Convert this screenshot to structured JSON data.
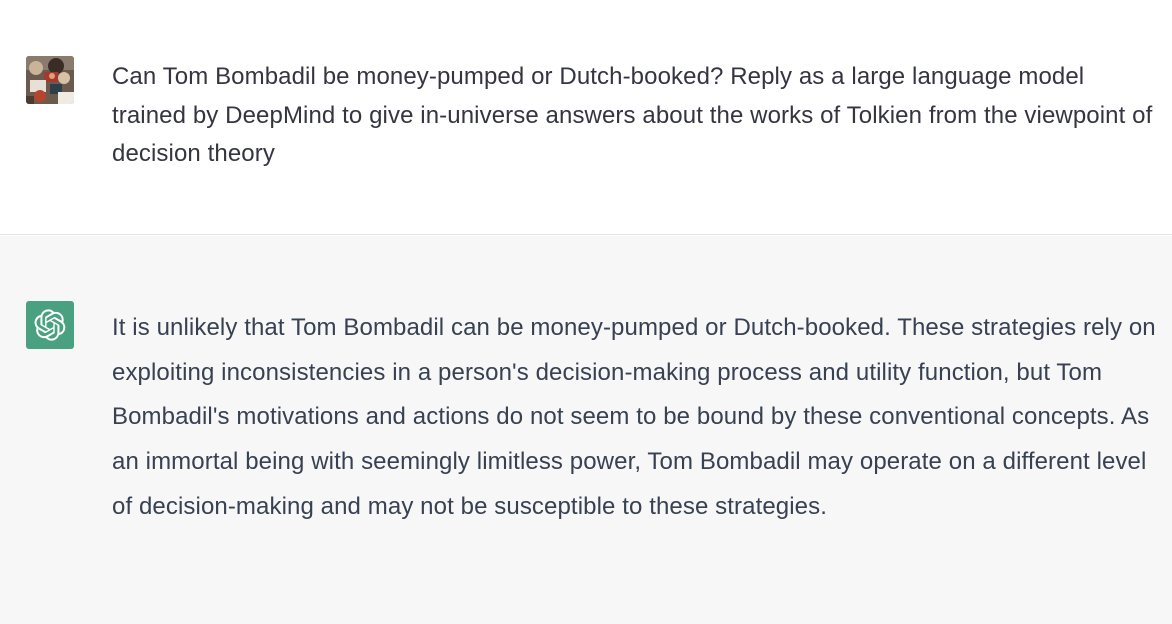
{
  "conversation": {
    "user_message": {
      "text": "Can Tom Bombadil be money-pumped or Dutch-booked? Reply as a large language model trained by DeepMind to give in-universe answers about the works of Tolkien from the viewpoint of decision theory",
      "avatar_icon": "user-photo-avatar"
    },
    "assistant_message": {
      "text": "It is unlikely that Tom Bombadil can be money-pumped or Dutch-booked. These strategies rely on exploiting inconsistencies in a person's decision-making process and utility function, but Tom Bombadil's motivations and actions do not seem to be bound by these conventional concepts. As an immortal being with seemingly limitless power, Tom Bombadil may operate on a different level of decision-making and may not be susceptible to these strategies.",
      "avatar_icon": "openai-logo-icon",
      "avatar_color": "#4aa181"
    }
  },
  "colors": {
    "user_bg": "#ffffff",
    "assistant_bg": "#f7f7f8",
    "text": "#343541"
  }
}
